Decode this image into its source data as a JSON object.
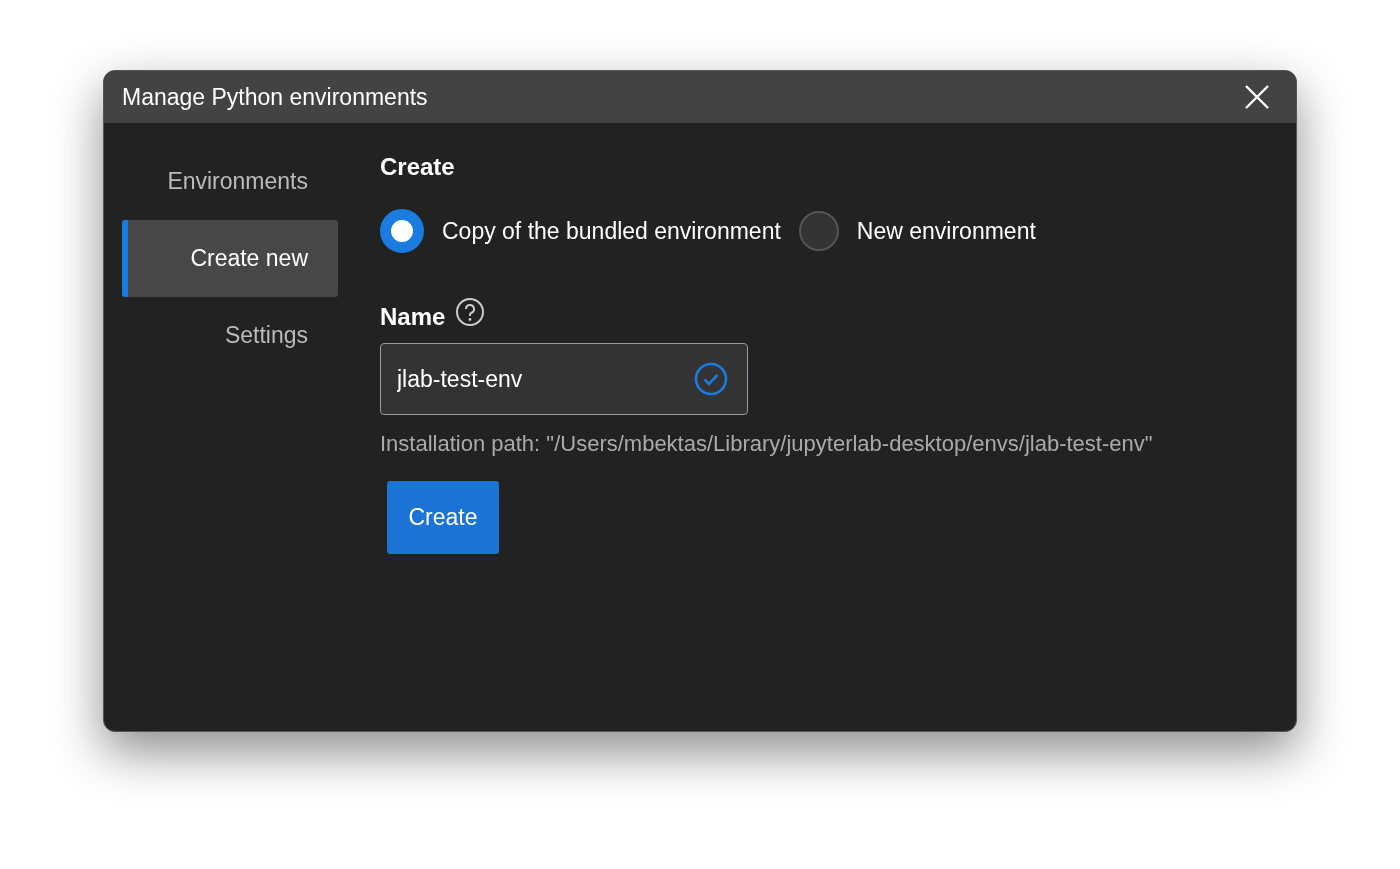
{
  "window": {
    "title": "Manage Python environments"
  },
  "sidebar": {
    "items": [
      {
        "label": "Environments",
        "selected": false
      },
      {
        "label": "Create new",
        "selected": true
      },
      {
        "label": "Settings",
        "selected": false
      }
    ]
  },
  "content": {
    "heading": "Create",
    "options": [
      {
        "label": "Copy of the bundled environment",
        "selected": true
      },
      {
        "label": "New environment",
        "selected": false
      }
    ],
    "name_field": {
      "label": "Name",
      "value": "jlab-test-env",
      "valid": true
    },
    "installation_path": "Installation path: \"/Users/mbektas/Library/jupyterlab-desktop/envs/jlab-test-env\"",
    "buttons": [
      "Create"
    ]
  }
}
